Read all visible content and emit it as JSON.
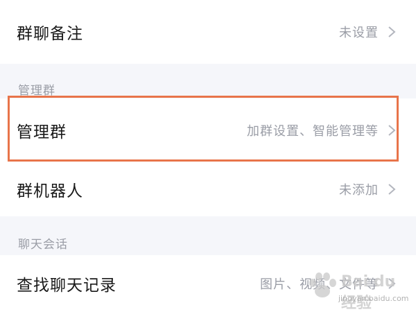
{
  "rows": {
    "group_remark": {
      "title": "群聊备注",
      "value": "未设置"
    },
    "manage_group": {
      "title": "管理群",
      "value": "加群设置、智能管理等"
    },
    "group_bot": {
      "title": "群机器人",
      "value": "未添加"
    },
    "search_history": {
      "title": "查找聊天记录",
      "value": "图片、视频、文件等"
    }
  },
  "sections": {
    "manage": "管理群",
    "chat": "聊天会话"
  },
  "watermark": {
    "brand": "Bai du 经验",
    "url": "jingyan.baidu.com"
  },
  "colors": {
    "highlight": "#e8744a",
    "background": "#f5f6fa",
    "secondary_text": "#9a9da6"
  }
}
